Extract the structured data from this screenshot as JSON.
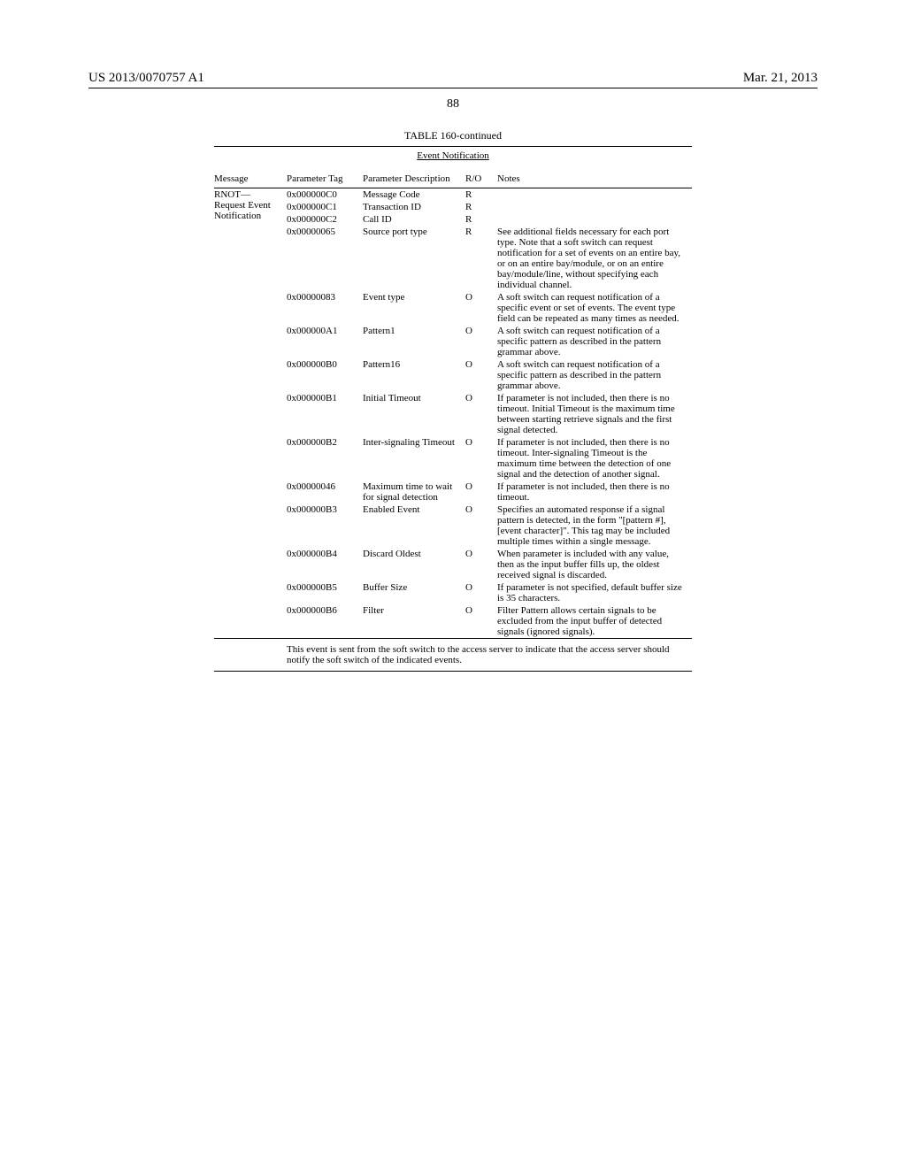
{
  "header": {
    "pubnum": "US 2013/0070757 A1",
    "pubdate": "Mar. 21, 2013"
  },
  "page_number": "88",
  "table": {
    "title": "TABLE 160-continued",
    "section": "Event Notification",
    "columns": {
      "message": "Message",
      "tag": "Parameter Tag",
      "desc": "Parameter Description",
      "ro": "R/O",
      "notes": "Notes"
    },
    "message_label": "RNOT—Request Event Notification",
    "rows": [
      {
        "tag": "0x000000C0",
        "desc": "Message Code",
        "ro": "R",
        "notes": ""
      },
      {
        "tag": "0x000000C1",
        "desc": "Transaction ID",
        "ro": "R",
        "notes": ""
      },
      {
        "tag": "0x000000C2",
        "desc": "Call ID",
        "ro": "R",
        "notes": ""
      },
      {
        "tag": "0x00000065",
        "desc": "Source port type",
        "ro": "R",
        "notes": "See additional fields necessary for each port type. Note that a soft switch can request notification for a set of events on an entire bay, or on an entire bay/module, or on an entire bay/module/line, without specifying each individual channel."
      },
      {
        "tag": "0x00000083",
        "desc": "Event type",
        "ro": "O",
        "notes": "A soft switch can request notification of a specific event or set of events. The event type field can be repeated as many times as needed."
      },
      {
        "tag": "0x000000A1",
        "desc": "Pattern1",
        "ro": "O",
        "notes": "A soft switch can request notification of a specific pattern as described in the pattern grammar above."
      },
      {
        "tag": "0x000000B0",
        "desc": "Pattern16",
        "ro": "O",
        "notes": "A soft switch can request notification of a specific pattern as described in the pattern grammar above."
      },
      {
        "tag": "0x000000B1",
        "desc": "Initial Timeout",
        "ro": "O",
        "notes": "If parameter is not included, then there is no timeout. Initial Timeout is the maximum time between starting retrieve signals and the first signal detected."
      },
      {
        "tag": "0x000000B2",
        "desc": "Inter-signaling Timeout",
        "ro": "O",
        "notes": "If parameter is not included, then there is no timeout. Inter-signaling Timeout is the maximum time between the detection of one signal and the detection of another signal."
      },
      {
        "tag": "0x00000046",
        "desc": "Maximum time to wait for signal detection",
        "ro": "O",
        "notes": "If parameter is not included, then there is no timeout."
      },
      {
        "tag": "0x000000B3",
        "desc": "Enabled Event",
        "ro": "O",
        "notes": "Specifies an automated response if a signal pattern is detected, in the form \"[pattern #], [event character]\". This tag may be included multiple times within a single message."
      },
      {
        "tag": "0x000000B4",
        "desc": "Discard Oldest",
        "ro": "O",
        "notes": "When parameter is included with any value, then as the input buffer fills up, the oldest received signal is discarded."
      },
      {
        "tag": "0x000000B5",
        "desc": "Buffer Size",
        "ro": "O",
        "notes": "If parameter is not specified, default buffer size is 35 characters."
      },
      {
        "tag": "0x000000B6",
        "desc": "Filter",
        "ro": "O",
        "notes": "Filter Pattern allows certain signals to be excluded from the input buffer of detected signals (ignored signals)."
      }
    ],
    "footnote": "This event is sent from the soft switch to the access server to indicate that the access server should notify the soft switch of the indicated events."
  }
}
